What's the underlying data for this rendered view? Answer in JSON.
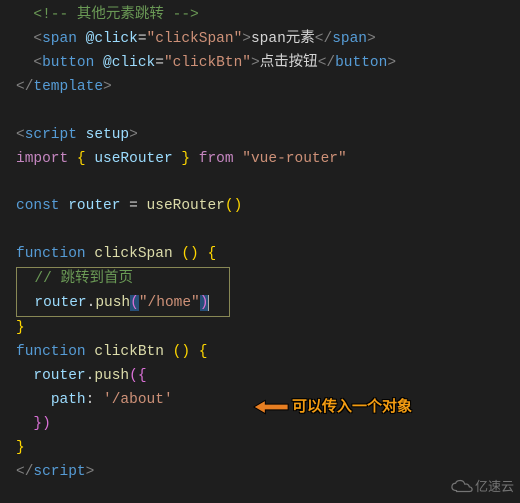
{
  "code": {
    "l1_comment": "<!-- 其他元素跳转 -->",
    "l2_tag": "span",
    "l2_event": "@click",
    "l2_handler": "clickSpan",
    "l2_text": "span元素",
    "l3_tag": "button",
    "l3_event": "@click",
    "l3_handler": "clickBtn",
    "l3_text": "点击按钮",
    "l4_tag": "template",
    "l6_tag": "script",
    "l6_attr": "setup",
    "l7_import": "import",
    "l7_item": "useRouter",
    "l7_from": "from",
    "l7_module": "\"vue-router\"",
    "l9_const": "const",
    "l9_var": "router",
    "l9_fn": "useRouter",
    "l11_kw": "function",
    "l11_name": "clickSpan",
    "l12_comment": "// 跳转到首页",
    "l13_obj": "router",
    "l13_method": "push",
    "l13_arg": "\"/home\"",
    "l15_kw": "function",
    "l15_name": "clickBtn",
    "l16_obj": "router",
    "l16_method": "push",
    "l17_key": "path",
    "l17_val": "'/about'",
    "l20_tag": "script"
  },
  "annotation": "可以传入一个对象",
  "watermark": "亿速云"
}
